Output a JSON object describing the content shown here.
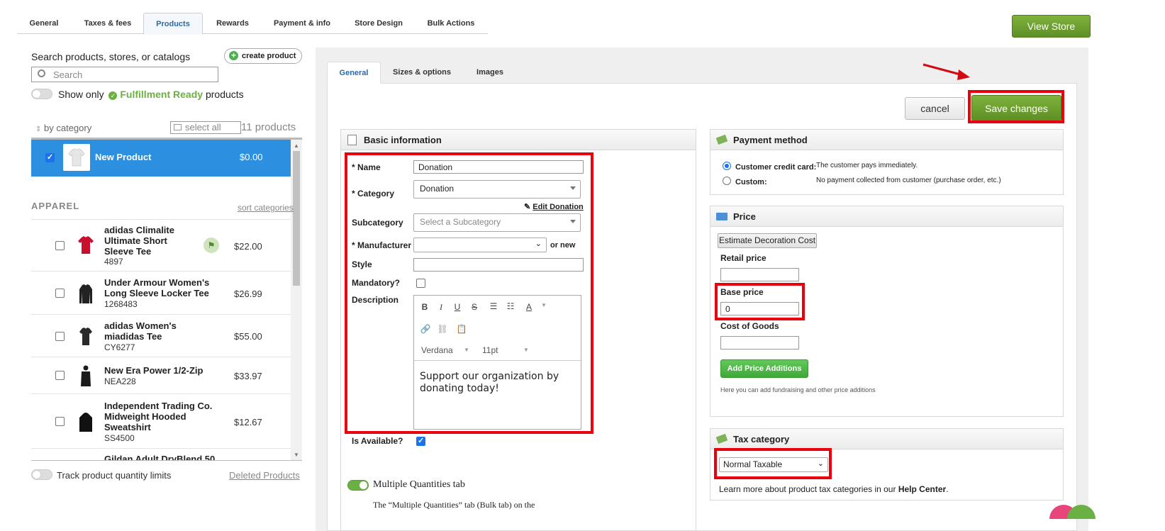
{
  "top_tabs": [
    "General",
    "Taxes & fees",
    "Products",
    "Rewards",
    "Payment & info",
    "Store Design",
    "Bulk Actions"
  ],
  "view_store_label": "View Store",
  "sidebar": {
    "search_label": "Search products, stores, or catalogs",
    "create_product_label": "create product",
    "search_placeholder": "Search",
    "show_only_label": "Show only",
    "fulfillment_label": "Fulfillment Ready",
    "products_word": "products",
    "by_category_label": "by category",
    "select_all_label": "select all",
    "product_count": "11 products",
    "selected_product": {
      "name": "New Product",
      "price": "$0.00"
    },
    "category_heading": "APPAREL",
    "sort_categories_label": "sort categories",
    "products": [
      {
        "name": "adidas Climalite Ultimate Short Sleeve Tee",
        "sku": "4897",
        "price": "$22.00",
        "color": "#c8102e"
      },
      {
        "name": "Under Armour Women's Long Sleeve Locker Tee",
        "sku": "1268483",
        "price": "$26.99",
        "color": "#222222"
      },
      {
        "name": "adidas Women's miadidas Tee",
        "sku": "CY6277",
        "price": "$55.00",
        "color": "#2a2a2a"
      },
      {
        "name": "New Era Power 1/2-Zip",
        "sku": "NEA228",
        "price": "$33.97",
        "color": "#1a1a1a"
      },
      {
        "name": "Independent Trading Co. Midweight Hooded Sweatshirt",
        "sku": "SS4500",
        "price": "$12.67",
        "color": "#111111"
      },
      {
        "name": "Gildan Adult DryBlend 50",
        "sku": "",
        "price": "",
        "color": "#333333"
      }
    ],
    "track_quantity_label": "Track product quantity limits",
    "deleted_products_label": "Deleted Products"
  },
  "sub_tabs": [
    "General",
    "Sizes & options",
    "Images"
  ],
  "actions": {
    "cancel_label": "cancel",
    "save_label": "Save changes"
  },
  "basic_info": {
    "title": "Basic information",
    "name_label": "* Name",
    "name_value": "Donation",
    "category_label": "* Category",
    "category_value": "Donation",
    "edit_category_label": "Edit Donation",
    "subcategory_label": "Subcategory",
    "subcategory_placeholder": "Select a Subcategory",
    "manufacturer_label": "* Manufacturer",
    "or_new_label": "or new",
    "style_label": "Style",
    "mandatory_label": "Mandatory?",
    "description_label": "Description",
    "font_family": "Verdana",
    "font_size": "11pt",
    "description_text": "Support our organization by donating today!",
    "available_label": "Is Available?",
    "multiple_quantities_label": "Multiple Quantities tab",
    "multiple_quantities_desc": "The “Multiple Quantities” tab (Bulk tab) on the"
  },
  "payment_method": {
    "title": "Payment method",
    "credit_label": "Customer credit card:",
    "credit_desc": "The customer pays immediately.",
    "custom_label": "Custom:",
    "custom_desc": "No payment collected from customer (purchase order, etc.)"
  },
  "price": {
    "title": "Price",
    "estimate_label": "Estimate Decoration Cost",
    "retail_label": "Retail price",
    "retail_value": "",
    "base_label": "Base price",
    "base_value": "0",
    "cost_label": "Cost of Goods",
    "cost_value": "",
    "add_additions_label": "Add Price Additions",
    "help_text": "Here you can add fundraising and other price additions"
  },
  "tax": {
    "title": "Tax category",
    "selected": "Normal Taxable",
    "learn_more": "Learn more about product tax categories in our",
    "help_center": "Help Center",
    "period": "."
  },
  "colors": {
    "accent_green": "#6a9e2f",
    "highlight_red": "#e8000d",
    "selected_blue": "#2d8fe0",
    "fulfillment_green": "#6bb043"
  }
}
